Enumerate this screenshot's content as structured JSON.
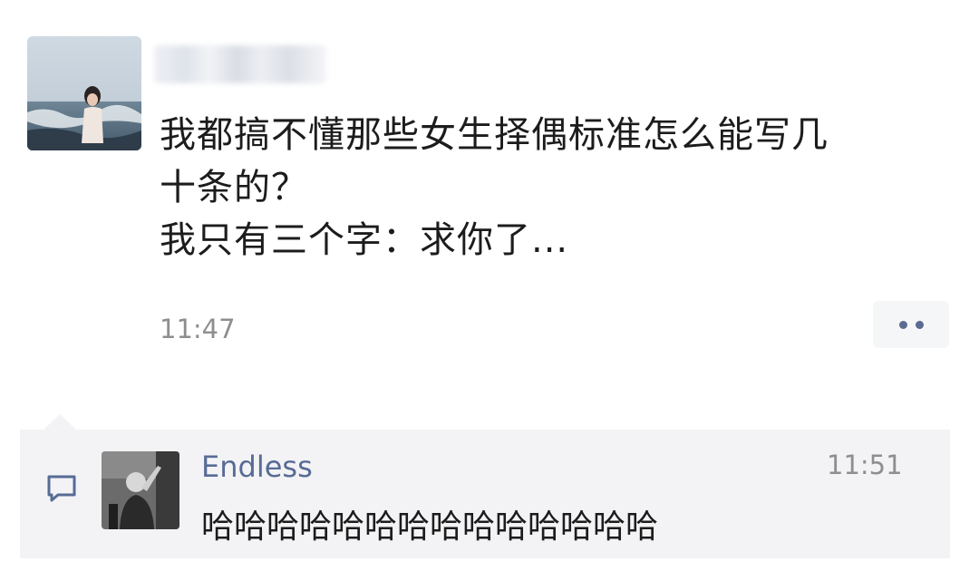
{
  "post": {
    "lines": [
      "我都搞不懂那些女生择偶标准怎么能写几",
      "十条的？",
      "我只有三个字：求你了..."
    ],
    "time": "11:47"
  },
  "comment": {
    "author": "Endless",
    "time": "11:51",
    "text": "哈哈哈哈哈哈哈哈哈哈哈哈哈哈"
  },
  "icons": {
    "more": "more-dots-icon",
    "comment": "comment-bubble-icon"
  },
  "colors": {
    "author_link": "#576b95",
    "timestamp": "#8e8e8e",
    "comment_background": "#f3f3f5"
  }
}
